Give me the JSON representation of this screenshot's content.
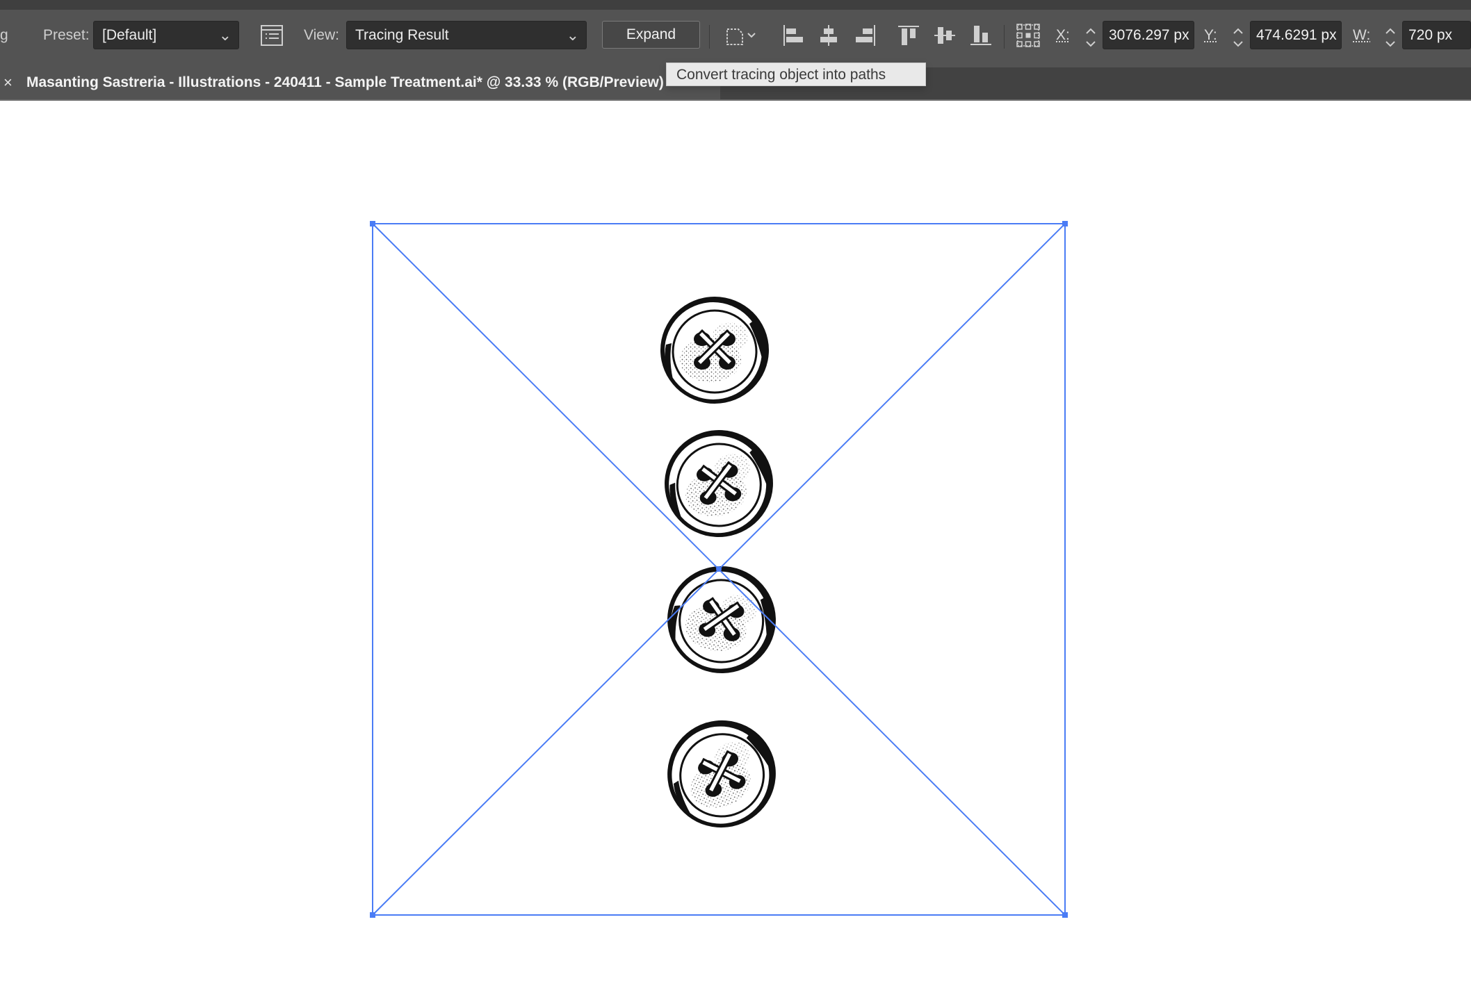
{
  "control_bar": {
    "truncated_label": "g",
    "preset_label": "Preset:",
    "preset_value": "[Default]",
    "view_label": "View:",
    "view_value": "Tracing Result",
    "expand_label": "Expand",
    "x_label": "X:",
    "x_value": "3076.297 px",
    "y_label": "Y:",
    "y_value": "474.6291 px",
    "w_label": "W:",
    "w_value": "720 px",
    "icons": [
      "tracing-panel-icon",
      "shape-mode-icon",
      "align-left-icon",
      "align-horizontal-center-icon",
      "align-right-icon",
      "align-top-icon",
      "align-vertical-center-icon",
      "align-bottom-icon",
      "reference-point-icon"
    ]
  },
  "document_tab": {
    "close_glyph": "×",
    "title": "Masanting Sastreria - Illustrations - 240411 - Sample Treatment.ai* @ 33.33 % (RGB/Preview)"
  },
  "tooltip": {
    "text": "Convert tracing object into paths"
  },
  "canvas": {
    "selection_color": "#4a7cf5",
    "artwork": "four-sewing-buttons-illustration"
  }
}
